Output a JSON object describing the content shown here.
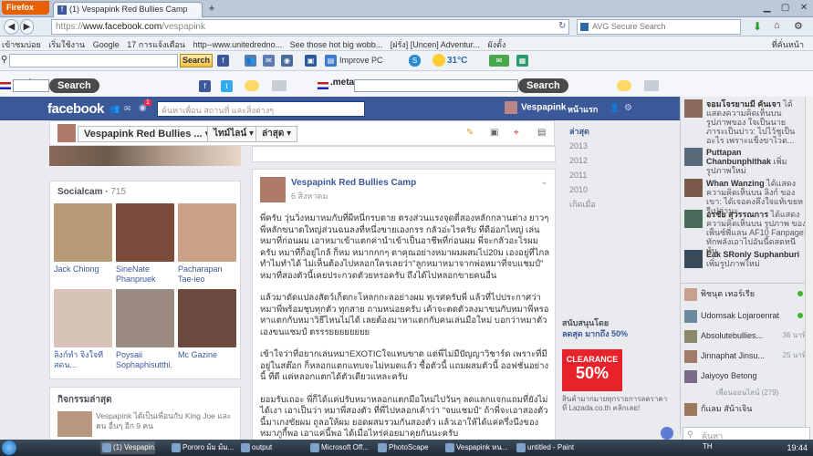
{
  "browser": {
    "menu_label": "Firefox",
    "tab_title": "(1) Vespapink Red Bullies Camp",
    "new_tab": "+",
    "url_host": "www.facebook.com",
    "url_path": "/vespapink",
    "url_prefix": "https://",
    "search_placeholder": "AVG Secure Search",
    "bookmarks": [
      "เข้าชมบ่อย",
      "เริ่มใช้งาน",
      "Google",
      "17 การแจ้งเตือน",
      "http--www.unitedredno...",
      "See those hot big wobb...",
      "[ฝรั่ง] [Uncen] Adventur...",
      "ผังตั้ง"
    ],
    "bookmarks_more": "ที่คั่นหน้า",
    "toolbar_search": "Search",
    "improve_pc": "Improve PC",
    "temperature": "31°C",
    "meta_label": ".meta",
    "meta_sublabel": "Search",
    "meta_btn": "Search"
  },
  "facebook": {
    "logo": "facebook",
    "search_placeholder": "ค้นหาเพื่อน สถานที่ และสิ่งต่างๆ",
    "user_name": "Vespapink",
    "home_label": "หน้าแรก",
    "page_selector": "Vespapink Red Bullies ...",
    "tab_recent": "ไทม์ไลน์",
    "tab_latest": "ล่าสุด",
    "friends_title": "Socialcam",
    "friends_count": "715",
    "friends": [
      {
        "name": "Jack Chiong",
        "color": "#b89a78"
      },
      {
        "name": "SineNate Phanpruek",
        "color": "#7a4a3a"
      },
      {
        "name": "Pacharapan Tae-ieo",
        "color": "#caa088"
      },
      {
        "name": "ลิงก์ทำ จิงใจที สดน...",
        "color": "#d7c3b8"
      },
      {
        "name": "Poysaii Sophaphisutthi.",
        "color": "#9a8a80"
      },
      {
        "name": "Mc Gazine",
        "color": "#6a4a40"
      }
    ],
    "activity_title": "กิจกรรมล่าสุด",
    "activity_text": "Vespapink ได้เป็นเพื่อนกับ King Joe และ คน อื่นๆ อีก 9 คน",
    "post": {
      "author": "Vespapink Red Bullies Camp",
      "date": "6 สิงหาคม",
      "paragraphs": [
        "พี่ครับ วุ่นวิ่งหมาหมกับที่ผีหนี่กรบตาย ตรงส่วนแรงจุดตี่สองหลักกลานต่าง ยาวๆ พี่หลักขนาดใหญ่ส่วนฉนลงที่หนึ่งขายเองกรร กลัวอ่ะไรครับ ที่ดีอ่อกไหญ่ เล่นหมาที่ก่อนผม เอาหมาเข้าแตกค่านำเข้าเป็นอาชีพที่ก่อนผม พี่จะกลัวอะไรผมครับ หมาที่ก็อยู่ไกล้ ก็หม หมากกกๆ ดาคุณอย่างหมาผมผสมไป20ม เองอยู่ที่ไกล ทำไมทำได้ ไม่เห็นต้องไปหลอกใครเลยว่า\"ลูกหมาหมาจากพ่อหมาที่จบแชมป์\" หมาที่สองตัวนี้เคยประกวดตัวยหรอครับ ถึงได้ไปหลอกขายคนอื่น",
        "แล้วมาดัดแปลงสัตว์เก็ตกะโหลกกะลอย่างผม ทุเรศครับพี่ แล้วที่ไปประกาศว่าหมาพี่พร้อมชุบทุกตัว ทุกสาย ถามหน่อยครับ เค้าจะตดตัวลงมาขนกับหมาพี่หรอ หาแตกกับหมาวิธีไหนไม่ได้ เลยต้องมาหาแตกกับคนเล่นมือใหม่ บอกว่าหมาตัวเองขนแชมป์ ตรรรยยยยยยยย",
        "เข้าใจว่าที่อยากเล่นหมาEXOTICใจแทบขาด แต่พี่ไม่มีปัญญาวิชาร์ด เพราะที่มีอยู่ในสต๊อก ก็หลอกแตกแทบจะไม่หมดแล้ว ซื้อตัวนี้ แถมผสมตัวนี้ ออฟชั่นอย่างนี้ ที่ดี แค่หลอกแตกได้ตัวเดียวแหละครับ",
        "ยอมรับเถอะ พี่ก็ได้แค่ปรับหมาหลอกแตกมือใหม่ไปวันๆ ลดแลกแจกแถมที่ยังไม่ได้เงา เอาเป็นว่า หมาพี่สองตัว ที่พี่ไปหลอกเค้าว่า \"จบแชมป์\" ถ้าพี่จะเอาสองตัวนี้มาเกงขัยผม ถูลอให้ผม ยอดผสมรวมกันสองตัว แล้วเอาให้ได้แค่ครึ่งนึงของหมาภูกี้พอ เอาแค่นี้พอ ได้เมื่อไหร่ค่อยมาคุยกันนะครับ"
      ]
    },
    "timeline_years": [
      "ล่าสุด",
      "2013",
      "2012",
      "2011",
      "2010",
      "เกิดเมื่อ"
    ],
    "ad": {
      "title": "สนับสนุนโดย",
      "brand_line": "ลดสุด มากถึง 50%",
      "clearance": "CLEARANCE",
      "percent": "50%",
      "body": "สินค้ามากมายทุกรายการลดราคาที่ Lazada.co.th คลิกเลย!"
    }
  },
  "sidebar": {
    "ticker": [
      {
        "name": "จอมโจรยามมี คันเจา",
        "text": "ได้แสดงความคิดเห็นบน รูปภาพของ ใจเป็นนาย ภาระเป็นบ่าว: ไปไว้ชูเป็นอะไร เพราะแข็งขาไวต...",
        "color": "#8a6a5a"
      },
      {
        "name": "Puttapan Chanbunphithak",
        "text": "เพิ่มรูปภาพใหม่",
        "color": "#5a6a7a"
      },
      {
        "name": "Whan Wanzing",
        "text": "ได้แสดงความคิดเห็นบน ลิงก์ ของเขา: ได้เจอคงคึงใจแท้เขยหรีเปล่านะ",
        "color": "#7a5a4a"
      },
      {
        "name": "อรชัย สุวรรณการ",
        "text": "ได้แสดงความคิดเห็นบน รูปภาพ ของ เพ็นซ์พี่แลน AF10 Fanpage: ทักพลังเอาไปอันนี้ดสดหนีพ้น",
        "color": "#4a6a5a"
      },
      {
        "name": "Eak SRonly Suphanburi",
        "text": "เพิ่มรูปภาพใหม่",
        "color": "#3a4a5a"
      }
    ],
    "chat_title": "เพื่อนออนไลน์ (279)",
    "chat": [
      {
        "name": "พิชนุต เทอร์เรีย",
        "time": "",
        "color": "#c8a090"
      },
      {
        "name": "Udomsak Lojaroenrat",
        "time": "",
        "color": "#6a8aa0"
      },
      {
        "name": "Absolutebullies...",
        "time": "36 นาที",
        "color": "#8a8a6a"
      },
      {
        "name": "Jinnaphat Jinsu...",
        "time": "25 นาที",
        "color": "#a07a6a"
      },
      {
        "name": "Jaiyoyo Betong",
        "time": "",
        "color": "#7a6a8a"
      },
      {
        "name": "ก้แลม สัน้าเจิน",
        "time": "",
        "color": "#9a7a5a"
      }
    ],
    "chat_search": "ค้นหา"
  },
  "taskbar": {
    "items": [
      "(1) Vespapin...",
      "Pororo ม้ม ม้ม...",
      "output",
      "Microsoft Off...",
      "PhotoScape",
      "Vespapink หน...",
      "untitled - Paint"
    ],
    "lang": "TH",
    "clock": "19:44"
  }
}
